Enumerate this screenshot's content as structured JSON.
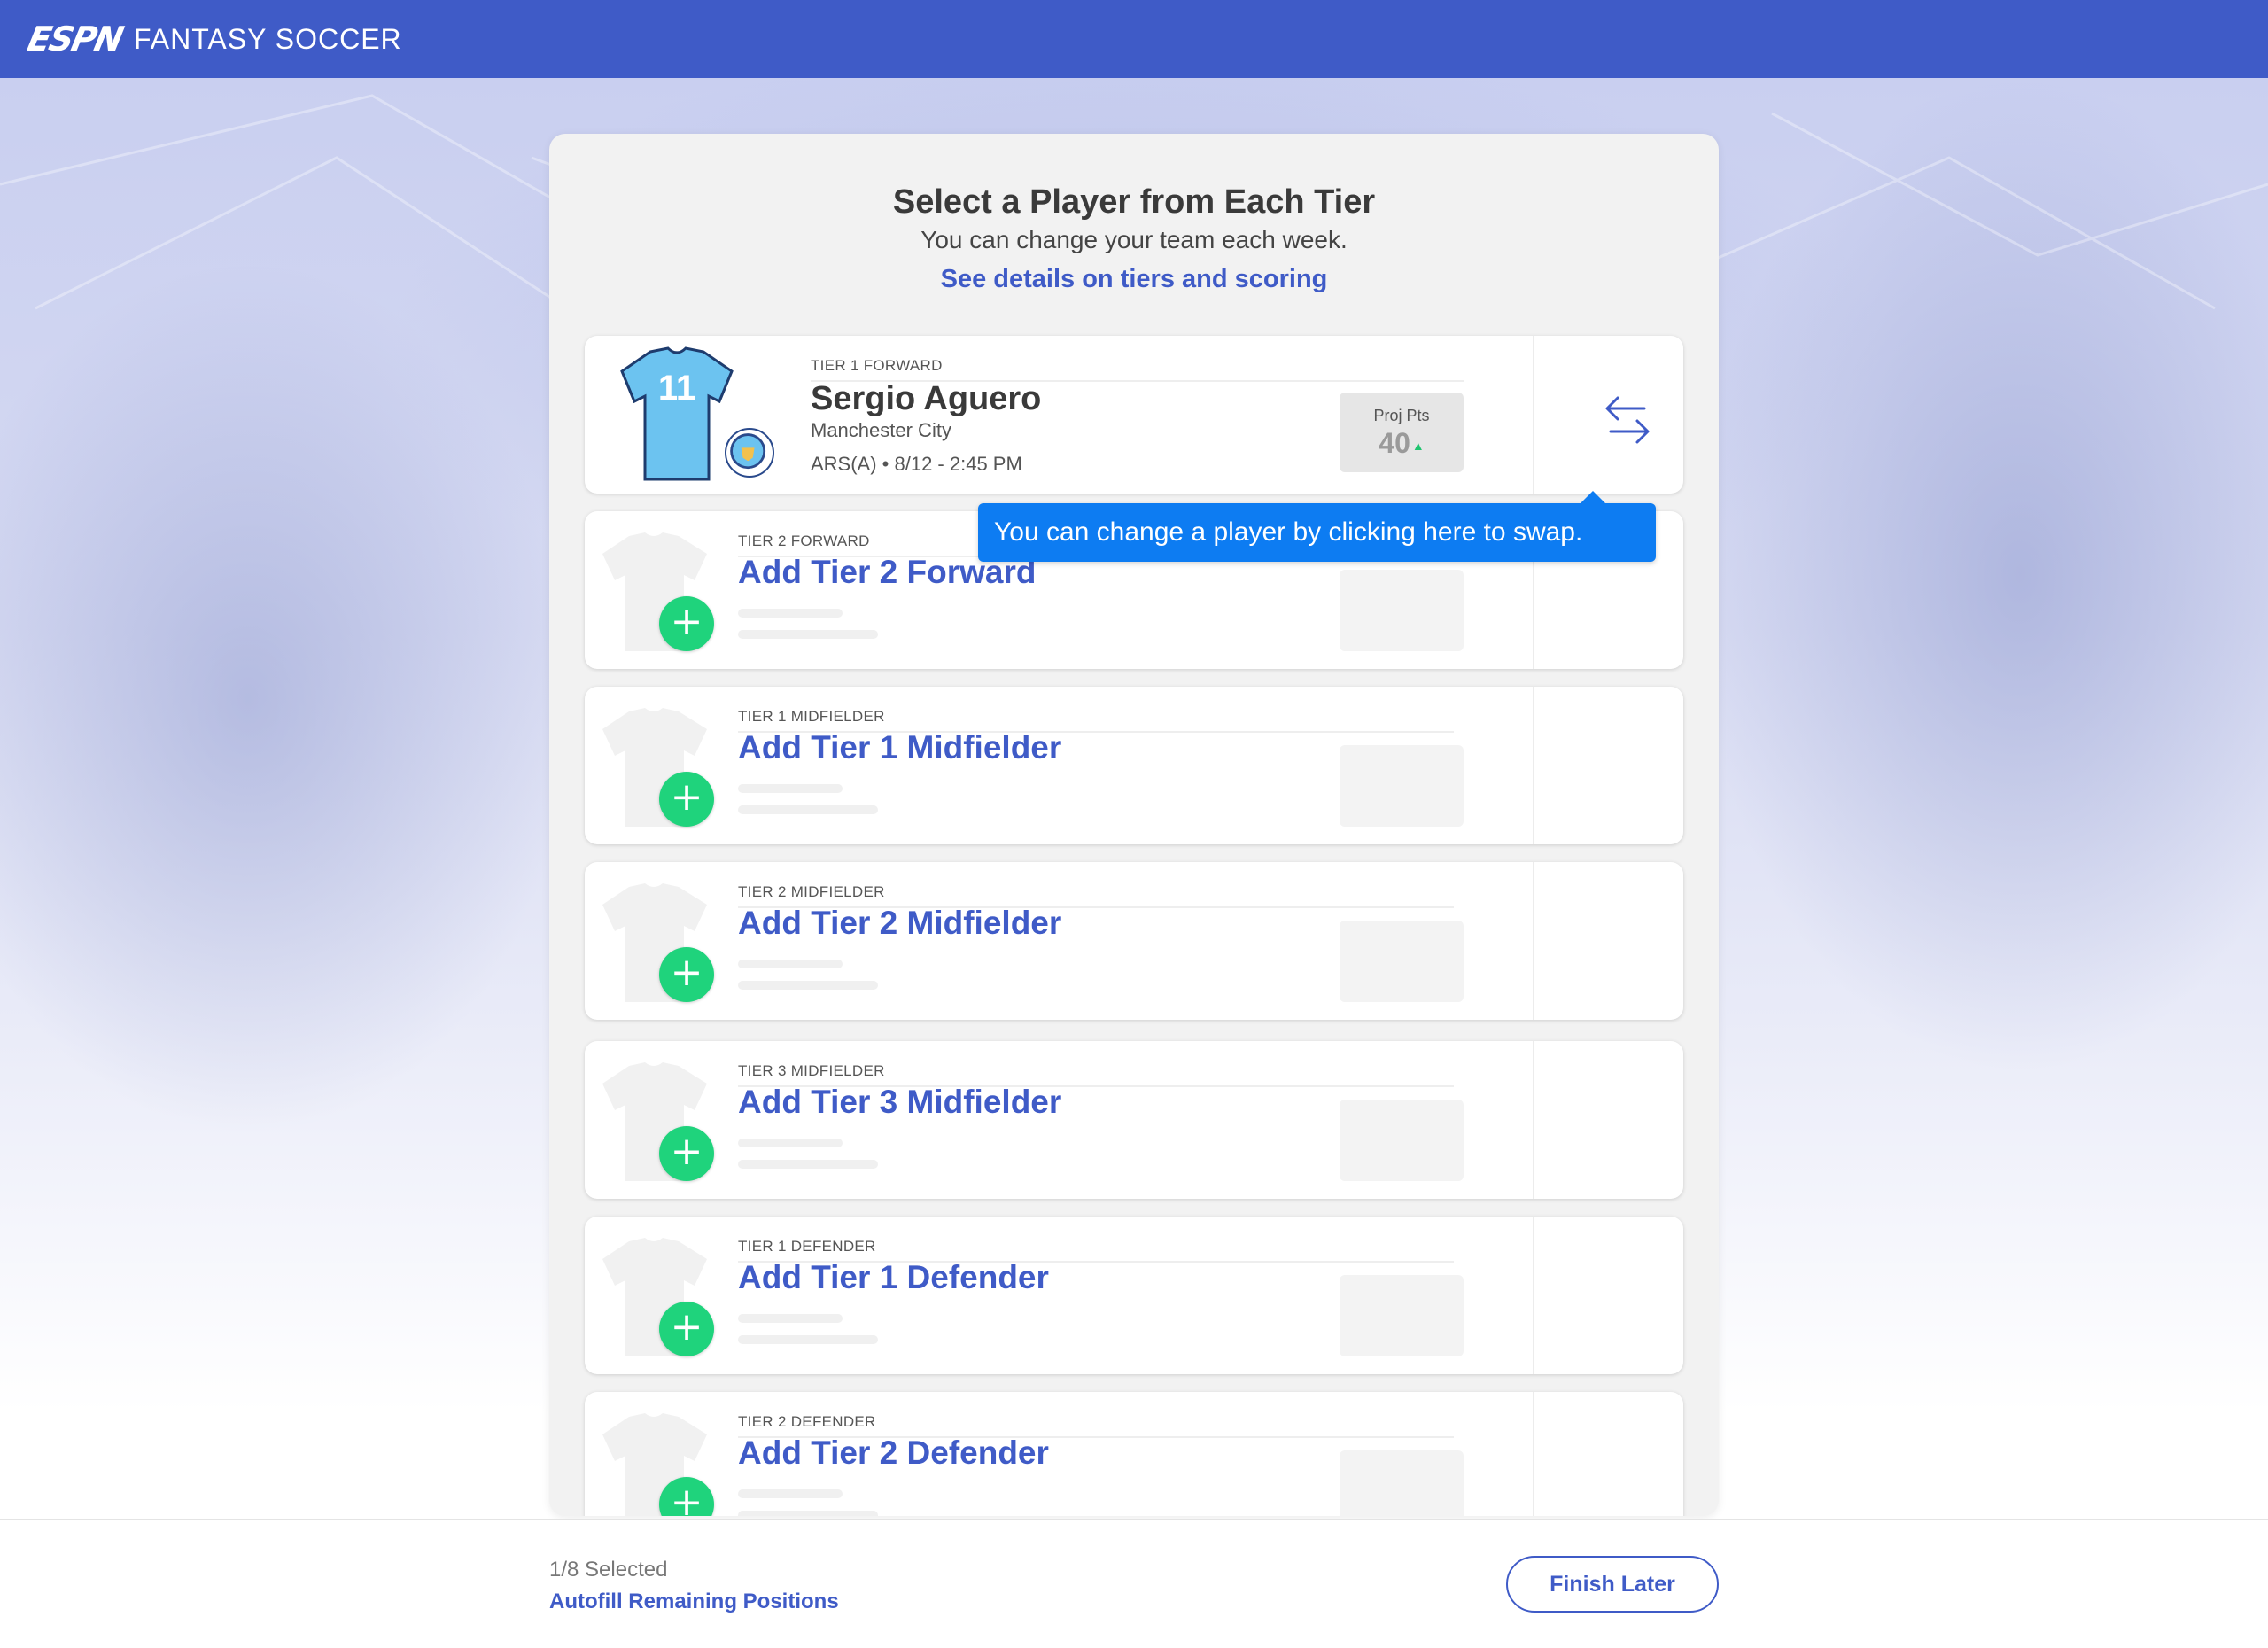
{
  "header": {
    "logo_text": "ESPN",
    "app_title": "FANTASY SOCCER"
  },
  "card": {
    "heading": "Select a Player from Each Tier",
    "subheading": "You can change your team each week.",
    "details_link": "See details on tiers and scoring"
  },
  "filled_slot": {
    "tier_label": "TIER 1 FORWARD",
    "player_name": "Sergio Aguero",
    "team": "Manchester City",
    "match": "ARS(A) • 8/12 - 2:45 PM",
    "shirt_number": "11",
    "proj_label": "Proj Pts",
    "proj_value": "40",
    "trend": "▲",
    "swap_icon": "swap-arrows-icon"
  },
  "tooltip": {
    "text": "You can change a player by clicking here to swap."
  },
  "empty_slots": [
    {
      "tier_label": "TIER 2 FORWARD",
      "add_label": "Add Tier 2 Forward"
    },
    {
      "tier_label": "TIER 1 MIDFIELDER",
      "add_label": "Add Tier 1 Midfielder"
    },
    {
      "tier_label": "TIER 2 MIDFIELDER",
      "add_label": "Add Tier 2 Midfielder"
    },
    {
      "tier_label": "TIER 3 MIDFIELDER",
      "add_label": "Add Tier 3 Midfielder"
    },
    {
      "tier_label": "TIER 1 DEFENDER",
      "add_label": "Add Tier 1 Defender"
    },
    {
      "tier_label": "TIER 2 DEFENDER",
      "add_label": "Add Tier 2 Defender"
    }
  ],
  "footer": {
    "selected_count": "1/8 Selected",
    "autofill_link": "Autofill Remaining Positions",
    "finish_button": "Finish Later"
  },
  "colors": {
    "brand": "#3f5bc7",
    "add_button": "#1fd37c",
    "tooltip": "#0d7cf2",
    "shirt": "#6cc3f0"
  }
}
